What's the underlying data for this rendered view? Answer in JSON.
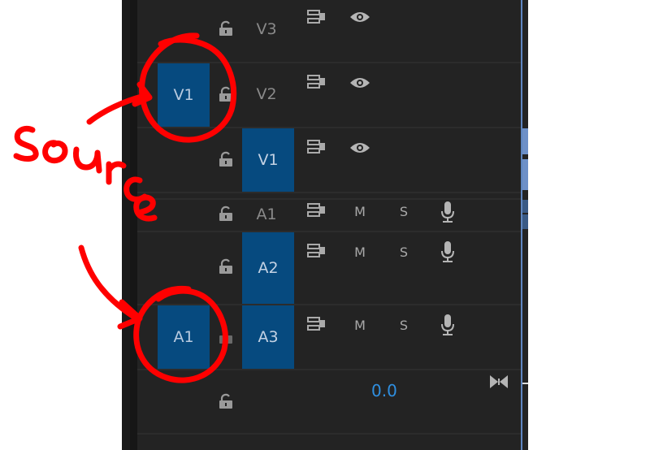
{
  "tracks": {
    "video": [
      {
        "name": "V3"
      },
      {
        "name": "V2",
        "source_patch": "V1"
      },
      {
        "name": "V1",
        "target_label": "V1"
      }
    ],
    "audio": [
      {
        "name": "A1"
      },
      {
        "name": "A2",
        "target_label": "A2"
      },
      {
        "name": "A3",
        "target_label": "A3",
        "source_patch": "A1"
      }
    ],
    "mute_label": "M",
    "solo_label": "S"
  },
  "master": {
    "volume": "0.0"
  },
  "annotation": {
    "text": "source",
    "color": "#ff0000"
  },
  "colors": {
    "panel_bg": "#232323",
    "patch_blue": "#064a7f",
    "volume_blue": "#2f8fe0",
    "playhead": "#5f86c0"
  },
  "icons": [
    "lock-icon",
    "sync-lock-icon",
    "eye-icon",
    "microphone-icon",
    "bowtie-icon"
  ]
}
